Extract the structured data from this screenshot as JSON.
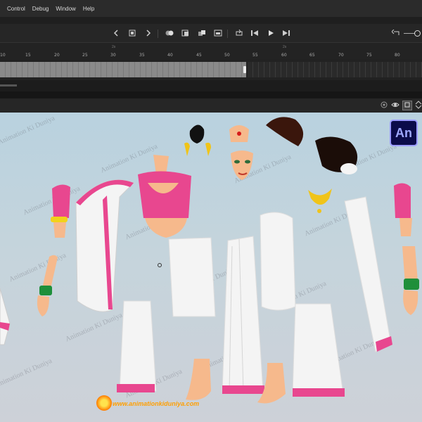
{
  "menu": {
    "items": [
      "Control",
      "Debug",
      "Window",
      "Help"
    ]
  },
  "toolbar": {
    "icons": [
      "prev-frame-icon",
      "stop-icon",
      "next-frame-icon",
      "onion-skin-icon",
      "onion-outline-icon",
      "edit-multiple-frames-icon",
      "frame-view-icon",
      "insert-frame-icon",
      "step-back-icon",
      "play-icon",
      "step-forward-icon",
      "undo-icon"
    ]
  },
  "timeline": {
    "ruler_labels": [
      "10",
      "15",
      "20",
      "25",
      "30",
      "35",
      "40",
      "45",
      "50",
      "55",
      "60",
      "65",
      "70",
      "75",
      "80"
    ],
    "ruler_minor_labels": [
      "2s",
      "2s"
    ]
  },
  "stage": {
    "watermark": "Animation Ki Duniya",
    "app_badge": "An",
    "website": "www.animationkiduniya.com",
    "colors": {
      "pink": "#e8478f",
      "white_cloth": "#f4f4f4",
      "skin": "#f6b98c",
      "hair": "#2a120a",
      "gold": "#f0c419",
      "bangle": "#1e8f3a"
    }
  }
}
